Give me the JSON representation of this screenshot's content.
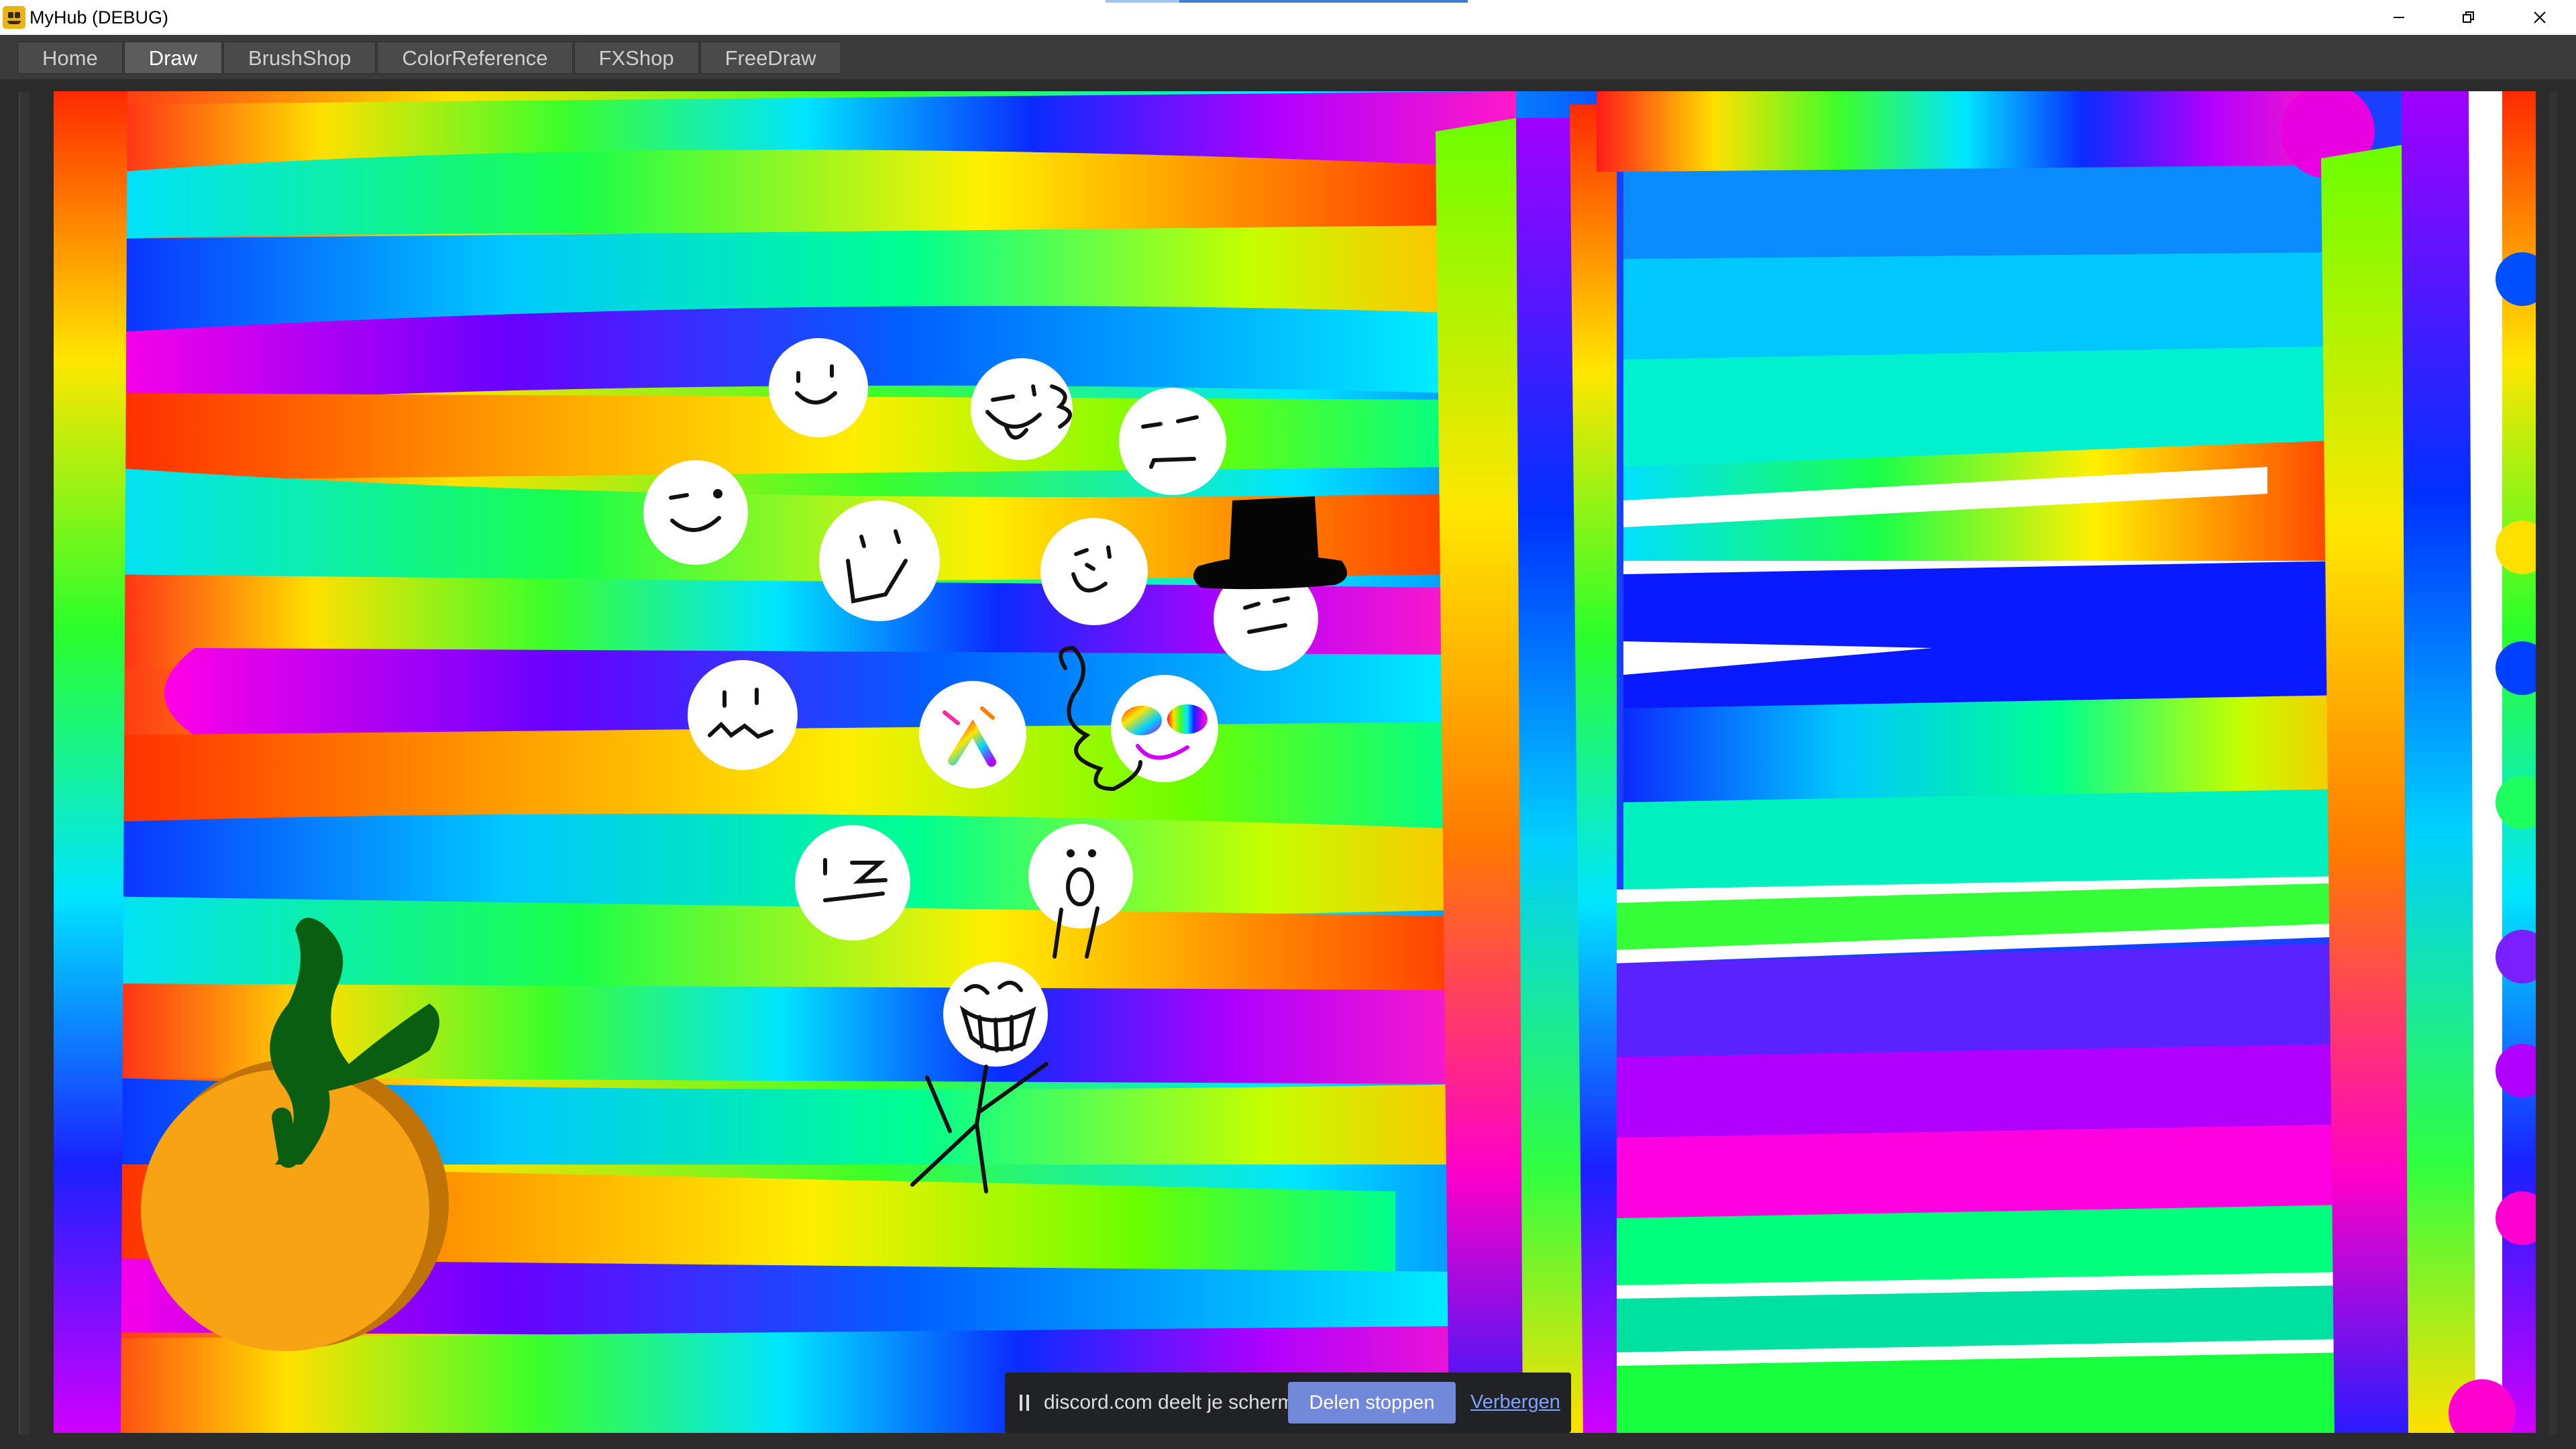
{
  "window": {
    "title": "MyHub (DEBUG)",
    "controls": {
      "minimize": "minimize",
      "maximize": "restore",
      "close": "close"
    }
  },
  "tabs": [
    {
      "label": "Home",
      "active": false
    },
    {
      "label": "Draw",
      "active": true
    },
    {
      "label": "BrushShop",
      "active": false
    },
    {
      "label": "ColorReference",
      "active": false
    },
    {
      "label": "FXShop",
      "active": false
    },
    {
      "label": "FreeDraw",
      "active": false
    }
  ],
  "canvas": {
    "description_icons": [
      "smiley-faces",
      "top-hat",
      "orange-fruit",
      "stick-figure"
    ],
    "colors": {
      "orange": "#f7a313",
      "leaf": "#0a5e12",
      "face": "#ffffff",
      "ink": "#111111"
    }
  },
  "share_notice": {
    "message": "discord.com deelt je scherm.",
    "stop_label": "Delen stoppen",
    "hide_label": "Verbergen",
    "accent": "#7289da"
  }
}
